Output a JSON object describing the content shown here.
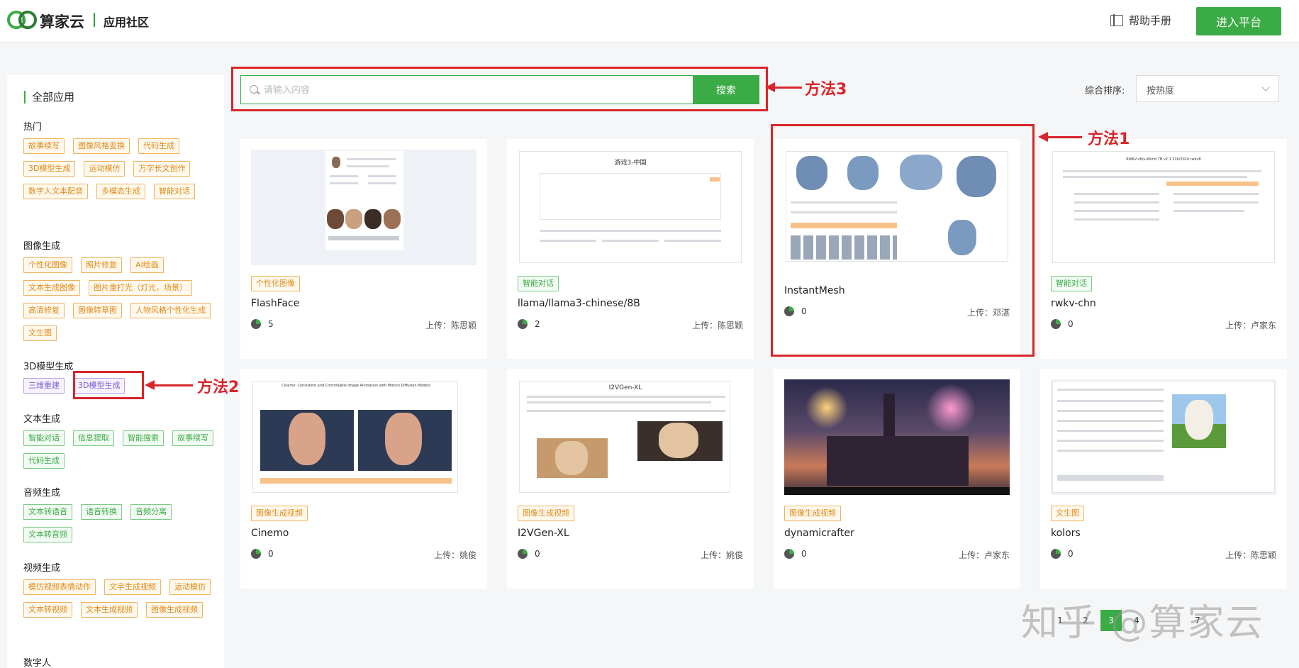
{
  "header": {
    "brand": "算家云",
    "subtitle": "应用社区",
    "help_label": "帮助手册",
    "enter_label": "进入平台"
  },
  "sidebar": {
    "title": "全部应用",
    "sections": [
      {
        "heading": "热门",
        "tags": [
          "故事续写",
          "图像风格变换",
          "代码生成",
          "3D模型生成",
          "运动模仿",
          "万字长文创作",
          "数字人文本配音",
          "多模态生成",
          "智能对话"
        ]
      },
      {
        "heading": "图像生成",
        "tags": [
          "个性化图像",
          "照片修复",
          "AI绘画",
          "文本生成图像",
          "图片重打光（灯光，场景）",
          "高清修复",
          "图像转草图",
          "人物风格个性化生成",
          "文生图"
        ]
      },
      {
        "heading": "3D模型生成",
        "tags": [
          "三维重建",
          "3D模型生成"
        ]
      },
      {
        "heading": "文本生成",
        "tags": [
          "智能对话",
          "信息提取",
          "智能搜索",
          "故事续写",
          "代码生成"
        ]
      },
      {
        "heading": "音频生成",
        "tags": [
          "文本转语音",
          "语音转换",
          "音频分离",
          "文本转音频"
        ]
      },
      {
        "heading": "视频生成",
        "tags": [
          "模仿视频表情动作",
          "文字生成视频",
          "运动模仿",
          "文本转视频",
          "文本生成视频",
          "图像生成视频"
        ]
      },
      {
        "heading": "数字人",
        "tags": []
      }
    ]
  },
  "search": {
    "placeholder": "请输入内容",
    "button": "搜索"
  },
  "sort": {
    "label": "综合排序:",
    "value": "按热度"
  },
  "cards": [
    {
      "tag": "个性化图像",
      "title": "FlashFace",
      "count": "5",
      "uploader": "上传：陈思颖"
    },
    {
      "tag": "智能对话",
      "title": "llama/llama3-chinese/8B",
      "count": "2",
      "uploader": "上传：陈思颖"
    },
    {
      "tag": "",
      "title": "InstantMesh",
      "count": "0",
      "uploader": "上传：邓湛"
    },
    {
      "tag": "智能对话",
      "title": "rwkv-chn",
      "count": "0",
      "uploader": "上传：卢家东"
    },
    {
      "tag": "图像生成视频",
      "title": "Cinemo",
      "count": "0",
      "uploader": "上传：姚俊"
    },
    {
      "tag": "图像生成视频",
      "title": "I2VGen-XL",
      "count": "0",
      "uploader": "上传：姚俊"
    },
    {
      "tag": "图像生成视频",
      "title": "dynamicrafter",
      "count": "0",
      "uploader": "上传：卢家东"
    },
    {
      "tag": "文生图",
      "title": "kolors",
      "count": "0",
      "uploader": "上传：陈思颖"
    }
  ],
  "thumbs": {
    "llama_title": "游戏3-中国",
    "cinemo_title": "Cinemo: Consistent and Controllable Image Animation with Motion Diffusion Models",
    "i2vgen_title": "I2VGen-XL",
    "rwkv_title": "RWKV-v6/v-World 7B v2.1 32k/2024 rwkv6"
  },
  "annotations": {
    "m1": "方法1",
    "m2": "方法2",
    "m3": "方法3"
  },
  "pagination": [
    "1",
    "2",
    "3",
    "4",
    "7"
  ],
  "watermark": "知乎 @算家云",
  "colors": {
    "accent": "#3bab45",
    "annotation": "#d9252b"
  }
}
